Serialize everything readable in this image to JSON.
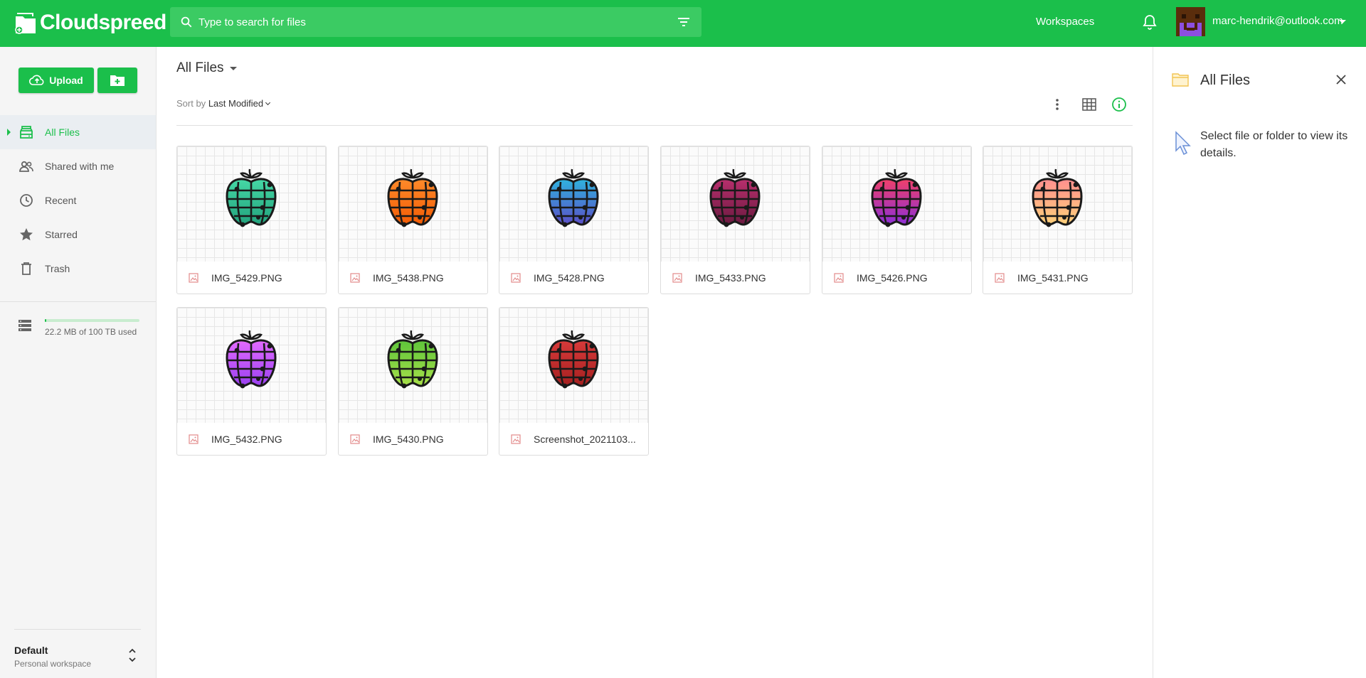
{
  "app": {
    "name": "Cloudspreed"
  },
  "header": {
    "search_placeholder": "Type to search for files",
    "workspaces_label": "Workspaces",
    "user_email": "marc-hendrik@outlook.com"
  },
  "sidebar": {
    "upload_label": "Upload",
    "items": [
      {
        "label": "All Files",
        "icon": "hard-drive-icon",
        "active": true
      },
      {
        "label": "Shared with me",
        "icon": "people-icon"
      },
      {
        "label": "Recent",
        "icon": "clock-icon"
      },
      {
        "label": "Starred",
        "icon": "star-icon"
      },
      {
        "label": "Trash",
        "icon": "trash-icon"
      }
    ],
    "storage_text": "22.2 MB of 100 TB used",
    "storage_fraction": 0.0002,
    "workspace": {
      "name": "Default",
      "subtitle": "Personal workspace"
    }
  },
  "main": {
    "breadcrumb": "All Files",
    "sort_prefix": "Sort by",
    "sort_value": "Last Modified",
    "files": [
      {
        "name": "IMG_5429.PNG",
        "colors": [
          "#46d8a6",
          "#22a27c"
        ]
      },
      {
        "name": "IMG_5438.PNG",
        "colors": [
          "#ff8a2a",
          "#f25c05"
        ]
      },
      {
        "name": "IMG_5428.PNG",
        "colors": [
          "#2fb3de",
          "#5b4fc8"
        ]
      },
      {
        "name": "IMG_5433.PNG",
        "colors": [
          "#b82f6d",
          "#6b1a40"
        ]
      },
      {
        "name": "IMG_5426.PNG",
        "colors": [
          "#f0406a",
          "#8d2fd6"
        ]
      },
      {
        "name": "IMG_5431.PNG",
        "colors": [
          "#ff8f8f",
          "#ffd07a"
        ]
      },
      {
        "name": "IMG_5432.PNG",
        "colors": [
          "#e36bff",
          "#9a40f0"
        ]
      },
      {
        "name": "IMG_5430.PNG",
        "colors": [
          "#5ec43a",
          "#a8e04a"
        ]
      },
      {
        "name": "Screenshot_2021103...",
        "colors": [
          "#d83a3a",
          "#a52020"
        ]
      }
    ]
  },
  "panel": {
    "title": "All Files",
    "hint": "Select file or folder to view its details."
  },
  "colors": {
    "brand": "#1bbf4b",
    "search_bg": "#3bcb63"
  }
}
